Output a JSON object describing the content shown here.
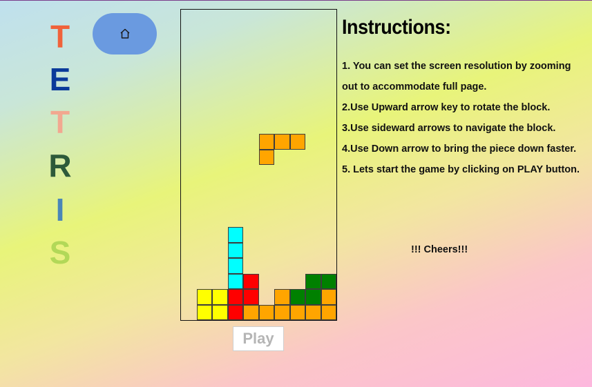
{
  "title_letters": [
    {
      "char": "T",
      "color": "#f0623a"
    },
    {
      "char": "E",
      "color": "#0a3a9a"
    },
    {
      "char": "T",
      "color": "#f2a890"
    },
    {
      "char": "R",
      "color": "#2d5a3a"
    },
    {
      "char": "I",
      "color": "#4a86b8"
    },
    {
      "char": "S",
      "color": "#b2d858"
    }
  ],
  "home_button": {
    "icon": "home-icon"
  },
  "board": {
    "cols": 10,
    "rows": 20,
    "cells": [
      {
        "col": 5,
        "row": 8,
        "color": "#ffa500"
      },
      {
        "col": 6,
        "row": 8,
        "color": "#ffa500"
      },
      {
        "col": 7,
        "row": 8,
        "color": "#ffa500"
      },
      {
        "col": 5,
        "row": 9,
        "color": "#ffa500"
      },
      {
        "col": 3,
        "row": 14,
        "color": "#00ffff"
      },
      {
        "col": 3,
        "row": 15,
        "color": "#00ffff"
      },
      {
        "col": 3,
        "row": 16,
        "color": "#00ffff"
      },
      {
        "col": 3,
        "row": 17,
        "color": "#00ffff"
      },
      {
        "col": 4,
        "row": 17,
        "color": "#ff0000"
      },
      {
        "col": 8,
        "row": 17,
        "color": "#008000"
      },
      {
        "col": 9,
        "row": 17,
        "color": "#008000"
      },
      {
        "col": 1,
        "row": 18,
        "color": "#ffff00"
      },
      {
        "col": 2,
        "row": 18,
        "color": "#ffff00"
      },
      {
        "col": 3,
        "row": 18,
        "color": "#ff0000"
      },
      {
        "col": 4,
        "row": 18,
        "color": "#ff0000"
      },
      {
        "col": 6,
        "row": 18,
        "color": "#ffa500"
      },
      {
        "col": 7,
        "row": 18,
        "color": "#008000"
      },
      {
        "col": 8,
        "row": 18,
        "color": "#008000"
      },
      {
        "col": 9,
        "row": 18,
        "color": "#ffa500"
      },
      {
        "col": 1,
        "row": 19,
        "color": "#ffff00"
      },
      {
        "col": 2,
        "row": 19,
        "color": "#ffff00"
      },
      {
        "col": 3,
        "row": 19,
        "color": "#ff0000"
      },
      {
        "col": 4,
        "row": 19,
        "color": "#ffa500"
      },
      {
        "col": 5,
        "row": 19,
        "color": "#ffa500"
      },
      {
        "col": 6,
        "row": 19,
        "color": "#ffa500"
      },
      {
        "col": 7,
        "row": 19,
        "color": "#ffa500"
      },
      {
        "col": 8,
        "row": 19,
        "color": "#ffa500"
      },
      {
        "col": 9,
        "row": 19,
        "color": "#ffa500"
      }
    ]
  },
  "play_button": {
    "label": "Play"
  },
  "instructions": {
    "title": "Instructions:",
    "items": [
      "1. You can set the screen resolution by zooming out to accommodate full page.",
      "2.Use Upward arrow key to rotate the block.",
      "3.Use sideward arrows to navigate the block.",
      "4.Use Down arrow to bring the piece down faster.",
      "5. Lets start the game by clicking on PLAY button."
    ],
    "cheers": "!!! Cheers!!!"
  }
}
